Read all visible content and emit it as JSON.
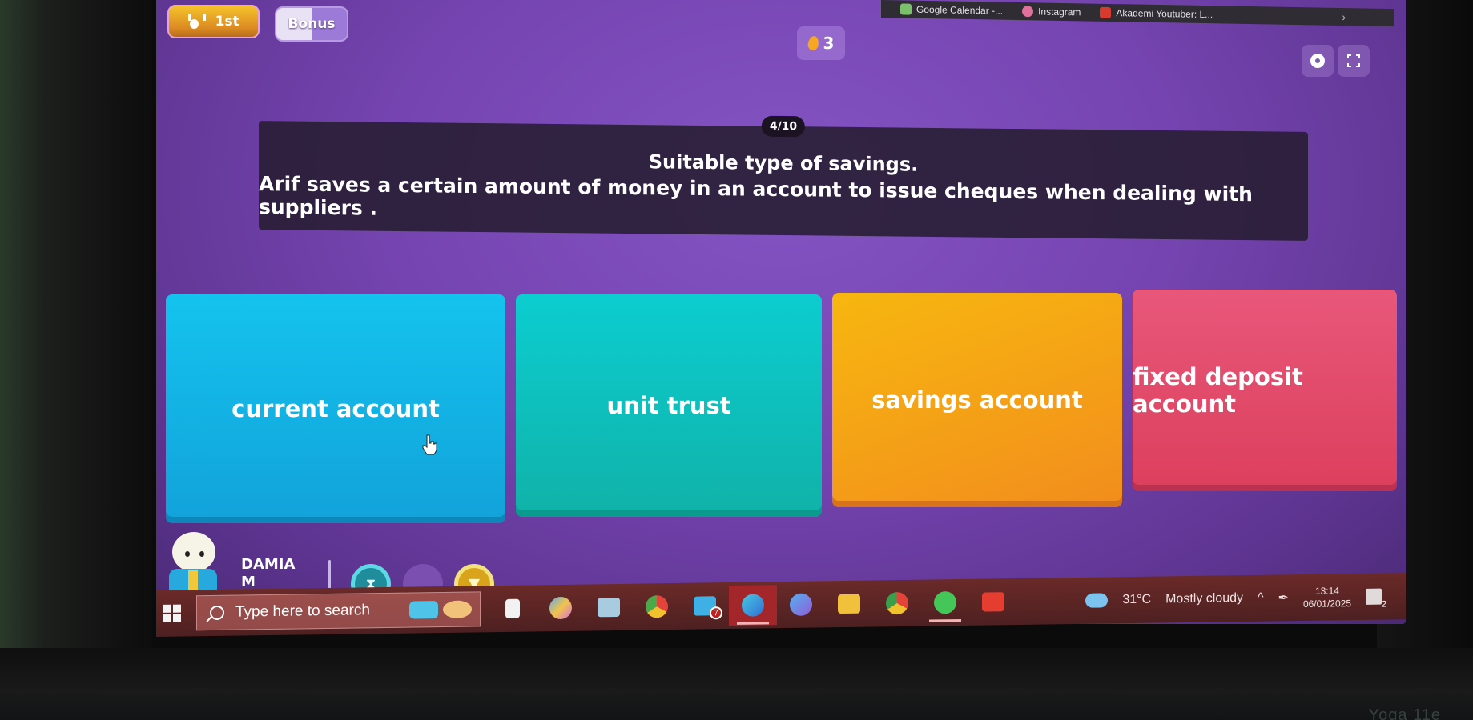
{
  "browser": {
    "bookmarks": [
      {
        "label": "Google Calendar -...",
        "icon": "google-calendar-icon",
        "color": "#7cbf6a"
      },
      {
        "label": "Instagram",
        "icon": "instagram-icon",
        "color": "#e0709c"
      },
      {
        "label": "Akademi Youtuber: L...",
        "icon": "youtube-icon",
        "color": "#d83a2e"
      }
    ],
    "more_icon": "chevron-right-icon"
  },
  "game": {
    "rank_label": "1st",
    "bonus_label": "Bonus",
    "streak_count": "3",
    "settings_icon": "gear-icon",
    "fullscreen_icon": "fullscreen-icon",
    "question": {
      "counter": "4/10",
      "title": "Suitable type of savings.",
      "text": "Arif saves a certain amount of money in an account to issue cheques when dealing with suppliers ."
    },
    "answers": [
      {
        "label": "current account",
        "color": "#14b6e8"
      },
      {
        "label": "unit trust",
        "color": "#0dc2bf"
      },
      {
        "label": "savings account",
        "color": "#f5a317"
      },
      {
        "label": "fixed deposit account",
        "color": "#e24b6b"
      }
    ],
    "player": {
      "name": "DAMIA M",
      "powerups": [
        "hourglass-icon",
        "empty-slot",
        "gold-bell-icon"
      ]
    }
  },
  "taskbar": {
    "search_placeholder": "Type here to search",
    "apps": [
      {
        "name": "task-view-icon",
        "color": "#f2f2f2"
      },
      {
        "name": "copilot-icon",
        "color": "#5fa8f2"
      },
      {
        "name": "camera-icon",
        "color": "#a9cbe0"
      },
      {
        "name": "chrome-icon",
        "color": "#4ca94a"
      },
      {
        "name": "mail-icon",
        "color": "#3fb0e6",
        "badge": "7"
      },
      {
        "name": "edge-icon",
        "color": "#2f93d6",
        "active": true
      },
      {
        "name": "microsoft-365-icon",
        "color": "#6a7fe0"
      },
      {
        "name": "file-explorer-icon",
        "color": "#f2c13b"
      },
      {
        "name": "chrome-profile-icon",
        "color": "#3c9e4a"
      },
      {
        "name": "whatsapp-icon",
        "color": "#45c659",
        "open": true
      },
      {
        "name": "youtube-icon",
        "color": "#e53e30"
      }
    ],
    "weather": {
      "temp": "31°C",
      "condition": "Mostly cloudy",
      "alert_count": "2"
    },
    "clock": {
      "time": "13:14",
      "date": "06/01/2025"
    },
    "notifications": "2"
  },
  "device": {
    "brand": "Yoga 11e"
  }
}
